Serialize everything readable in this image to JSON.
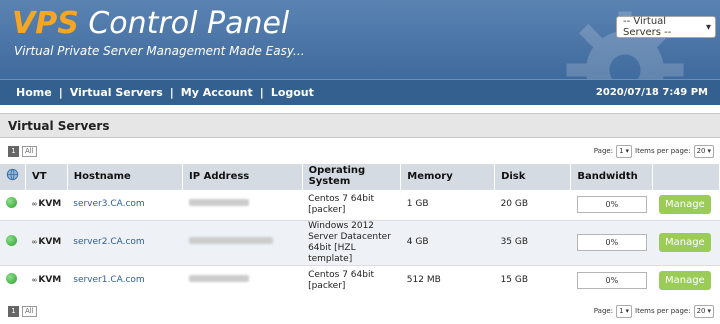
{
  "header": {
    "brand_accent": "VPS",
    "brand_rest": " Control Panel",
    "tagline": "Virtual Private Server Management Made Easy...",
    "server_select": "-- Virtual Servers --"
  },
  "nav": {
    "links": [
      "Home",
      "Virtual Servers",
      "My Account",
      "Logout"
    ],
    "separator": "|",
    "datetime": "2020/07/18 7:49 PM"
  },
  "panel": {
    "title": "Virtual Servers",
    "pages": [
      "1",
      "All"
    ],
    "page_label": "Page:",
    "page_value": "1",
    "per_page_label": "Items per page:",
    "per_page_value": "20"
  },
  "table": {
    "headers": [
      "",
      "VT",
      "Hostname",
      "IP Address",
      "Operating System",
      "Memory",
      "Disk",
      "Bandwidth",
      ""
    ],
    "rows": [
      {
        "vt": "KVM",
        "hostname": "server3.CA.com",
        "os": "Centos 7 64bit [packer]",
        "memory": "1 GB",
        "disk": "20 GB",
        "bandwidth": "0%",
        "action": "Manage"
      },
      {
        "vt": "KVM",
        "hostname": "server2.CA.com",
        "os": "Windows 2012 Server Datacenter 64bit [HZL template]",
        "memory": "4 GB",
        "disk": "35 GB",
        "bandwidth": "0%",
        "action": "Manage"
      },
      {
        "vt": "KVM",
        "hostname": "server1.CA.com",
        "os": "Centos 7 64bit [packer]",
        "memory": "512 MB",
        "disk": "15 GB",
        "bandwidth": "0%",
        "action": "Manage"
      }
    ]
  },
  "colors": {
    "header": "#4a76a8",
    "nav": "#33608f",
    "accent": "#f6a623",
    "manage": "#9bcc58",
    "status_online": "#2aa02a"
  },
  "icons": {
    "status": "status-online-icon",
    "globe": "globe-icon",
    "chevron": "chevron-down-icon",
    "gear": "gear-icon"
  }
}
